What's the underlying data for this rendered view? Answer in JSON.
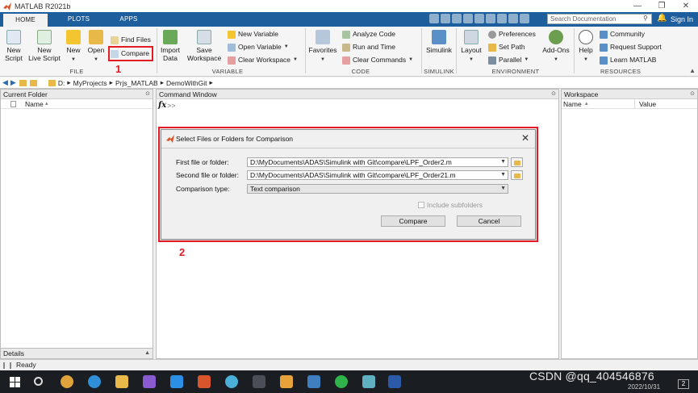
{
  "window": {
    "title": "MATLAB R2021b"
  },
  "tabs": [
    {
      "label": "HOME",
      "active": true
    },
    {
      "label": "PLOTS",
      "active": false
    },
    {
      "label": "APPS",
      "active": false
    }
  ],
  "search": {
    "placeholder": "Search Documentation"
  },
  "account": {
    "sign_in": "Sign In"
  },
  "ribbon": {
    "file": {
      "section": "FILE",
      "new_script": [
        "New",
        "Script"
      ],
      "new_live_script": [
        "New",
        "Live Script"
      ],
      "new": "New",
      "open": "Open",
      "find_files": "Find Files",
      "compare": "Compare"
    },
    "variable": {
      "section": "VARIABLE",
      "import_data": [
        "Import",
        "Data"
      ],
      "save_workspace": [
        "Save",
        "Workspace"
      ],
      "new_variable": "New Variable",
      "open_variable": "Open Variable",
      "clear_workspace": "Clear Workspace"
    },
    "code": {
      "section": "CODE",
      "favorites": "Favorites",
      "analyze_code": "Analyze Code",
      "run_and_time": "Run and Time",
      "clear_commands": "Clear Commands"
    },
    "simulink": {
      "section": "SIMULINK",
      "simulink": "Simulink"
    },
    "environment": {
      "section": "ENVIRONMENT",
      "layout": "Layout",
      "preferences": "Preferences",
      "set_path": "Set Path",
      "parallel": "Parallel",
      "add_ons": "Add-Ons"
    },
    "resources": {
      "section": "RESOURCES",
      "help": "Help",
      "community": "Community",
      "request_support": "Request Support",
      "learn_matlab": "Learn MATLAB"
    }
  },
  "address": {
    "path": [
      "D:",
      "MyProjects",
      "Prjs_MATLAB",
      "DemoWithGit"
    ]
  },
  "current_folder": {
    "title": "Current Folder",
    "col_name": "Name",
    "sort": "▴"
  },
  "command_window": {
    "title": "Command Window",
    "fx": "fx",
    "prompt": ">>"
  },
  "workspace": {
    "title": "Workspace",
    "col_name": "Name",
    "col_value": "Value",
    "sort": "▴"
  },
  "details": {
    "title": "Details"
  },
  "dialog": {
    "title": "Select Files or Folders for Comparison",
    "first_label": "First file or folder:",
    "first_value": "D:\\MyDocuments\\ADAS\\Simulink with Git\\compare\\LPF_Order2.m",
    "second_label": "Second file or folder:",
    "second_value": "D:\\MyDocuments\\ADAS\\Simulink with Git\\compare\\LPF_Order21.m",
    "type_label": "Comparison type:",
    "type_value": "Text comparison",
    "include_subfolders": "Include subfolders",
    "compare_btn": "Compare",
    "cancel_btn": "Cancel"
  },
  "annotations": {
    "one": "1",
    "two": "2"
  },
  "status": {
    "text": "Ready"
  },
  "taskbar": {
    "watermark": "CSDN @qq_404546876",
    "date": "2022/10/31",
    "badge": "2"
  },
  "colors": {
    "accent": "#1f5e9c",
    "highlight": "#e21b24",
    "taskbar": "#1a1d22"
  }
}
